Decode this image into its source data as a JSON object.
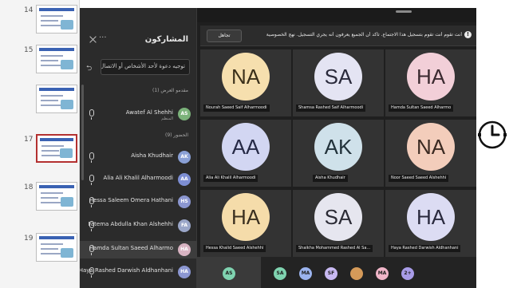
{
  "thumbnails": [
    {
      "number": "14",
      "active": false
    },
    {
      "number": "15",
      "active": false
    },
    {
      "number": "",
      "active": false
    },
    {
      "number": "17",
      "active": true
    },
    {
      "number": "18",
      "active": false
    },
    {
      "number": "19",
      "active": false
    }
  ],
  "panel": {
    "title": "المشاركون",
    "more_label": "···",
    "invite_placeholder": "توجيه دعوة لأحد الأشخاص أو الاتصال",
    "share_icon_glyph": "⮌",
    "group_presenters": "مقدمو العرض (1)",
    "group_attendees": "الحضور (9)",
    "participants": [
      {
        "name": "Awatef Al Shehhi",
        "sub": "المنظم",
        "initials": "AS",
        "color": "#7bb27a"
      },
      {
        "name": "Aisha Khudhair",
        "sub": "",
        "initials": "AK",
        "color": "#8aa0d6"
      },
      {
        "name": "Alia Ali Khalil Alharmoodi",
        "sub": "",
        "initials": "AA",
        "color": "#7d8ed3"
      },
      {
        "name": "Hessa Saleem Omera Hathani",
        "sub": "",
        "initials": "HS",
        "color": "#8b96d0"
      },
      {
        "name": "Fatema Abdulla Khan Alshehhi",
        "sub": "",
        "initials": "FA",
        "color": "#9aa6c8"
      },
      {
        "name": "Hamda Sultan Saeed Alharmo",
        "sub": "",
        "initials": "HA",
        "color": "#d8b3c2"
      },
      {
        "name": "Haya Rashed Darwish Aldhanhani",
        "sub": "",
        "initials": "HA",
        "color": "#8c97d2"
      }
    ]
  },
  "banner": {
    "text": "أنت تقوم أنت تقوم بتسجيل هذا الاجتماع. تأكد أن الجميع يعرفون أنه يجري التسجيل. نهج الخصوصية",
    "info_glyph": "!",
    "dismiss_label": "تجاهل"
  },
  "tiles": [
    {
      "initials": "HA",
      "bg": "#f2cfd8",
      "fg": "#3b2a30",
      "caption": "Hamda Sultan Saeed Alharmo"
    },
    {
      "initials": "SA",
      "bg": "#e4e4f3",
      "fg": "#2a2a3b",
      "caption": "Shamsa Rashed Saif Alharmoodi"
    },
    {
      "initials": "NA",
      "bg": "#f6dfae",
      "fg": "#3b301a",
      "caption": "Nourah Saeed Saif Alharmoodi"
    },
    {
      "initials": "NA",
      "bg": "#f3cdbb",
      "fg": "#3b2a22",
      "caption": "Noor Saeed Saeed Alshehhi"
    },
    {
      "initials": "AK",
      "bg": "#cfe1ea",
      "fg": "#22323a",
      "caption": "Aisha Khudhair"
    },
    {
      "initials": "AA",
      "bg": "#d2d6f2",
      "fg": "#262a46",
      "caption": "Alia Ali Khalil Alharmoodi"
    },
    {
      "initials": "HA",
      "bg": "#dcdcf3",
      "fg": "#2a2a3e",
      "caption": "Haya Rashed Darwish Aldhanhani"
    },
    {
      "initials": "SA",
      "bg": "#e6e6ef",
      "fg": "#2b2b35",
      "caption": "Shaikha Mohammed Rashed Al Sa..."
    },
    {
      "initials": "HA",
      "bg": "#f5dcaa",
      "fg": "#3b3020",
      "caption": "Hessa Khalid Saeed Alshehhi"
    }
  ],
  "bottom": {
    "self_initials": "AS",
    "chips": [
      {
        "initials": "SA",
        "color": "#7fd3b0"
      },
      {
        "initials": "MA",
        "color": "#9bb3ee"
      },
      {
        "initials": "SF",
        "color": "#c8b9f2"
      },
      {
        "initials": "",
        "color": "#d59a59"
      },
      {
        "initials": "MA",
        "color": "#f0b5c8"
      },
      {
        "initials": "2+",
        "color": "#a89ce8"
      }
    ]
  }
}
